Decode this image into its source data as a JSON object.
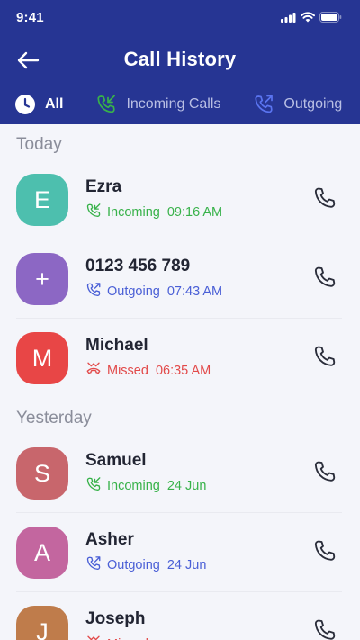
{
  "status_bar": {
    "time": "9:41"
  },
  "header": {
    "title": "Call History"
  },
  "tabs": [
    {
      "label": "All",
      "active": true
    },
    {
      "label": "Incoming Calls",
      "active": false
    },
    {
      "label": "Outgoing",
      "active": false
    }
  ],
  "sections": [
    {
      "title": "Today",
      "calls": [
        {
          "initial": "E",
          "name": "Ezra",
          "type": "Incoming",
          "time": "09:16 AM",
          "avatar_color": "#4dbfae"
        },
        {
          "initial": "+",
          "name": "0123 456 789",
          "type": "Outgoing",
          "time": "07:43 AM",
          "avatar_color": "#8c67c4"
        },
        {
          "initial": "M",
          "name": "Michael",
          "type": "Missed",
          "time": "06:35 AM",
          "avatar_color": "#e84646"
        }
      ]
    },
    {
      "title": "Yesterday",
      "calls": [
        {
          "initial": "S",
          "name": "Samuel",
          "type": "Incoming",
          "time": "24 Jun",
          "avatar_color": "#c8666c"
        },
        {
          "initial": "A",
          "name": "Asher",
          "type": "Outgoing",
          "time": "24 Jun",
          "avatar_color": "#c3669f"
        },
        {
          "initial": "J",
          "name": "Joseph",
          "type": "Missed",
          "time": "",
          "avatar_color": "#bf7c4b"
        }
      ]
    }
  ],
  "colors": {
    "header_bg": "#263593",
    "incoming": "#38b24a",
    "outgoing": "#4a5fd6",
    "missed": "#e24a4a"
  }
}
